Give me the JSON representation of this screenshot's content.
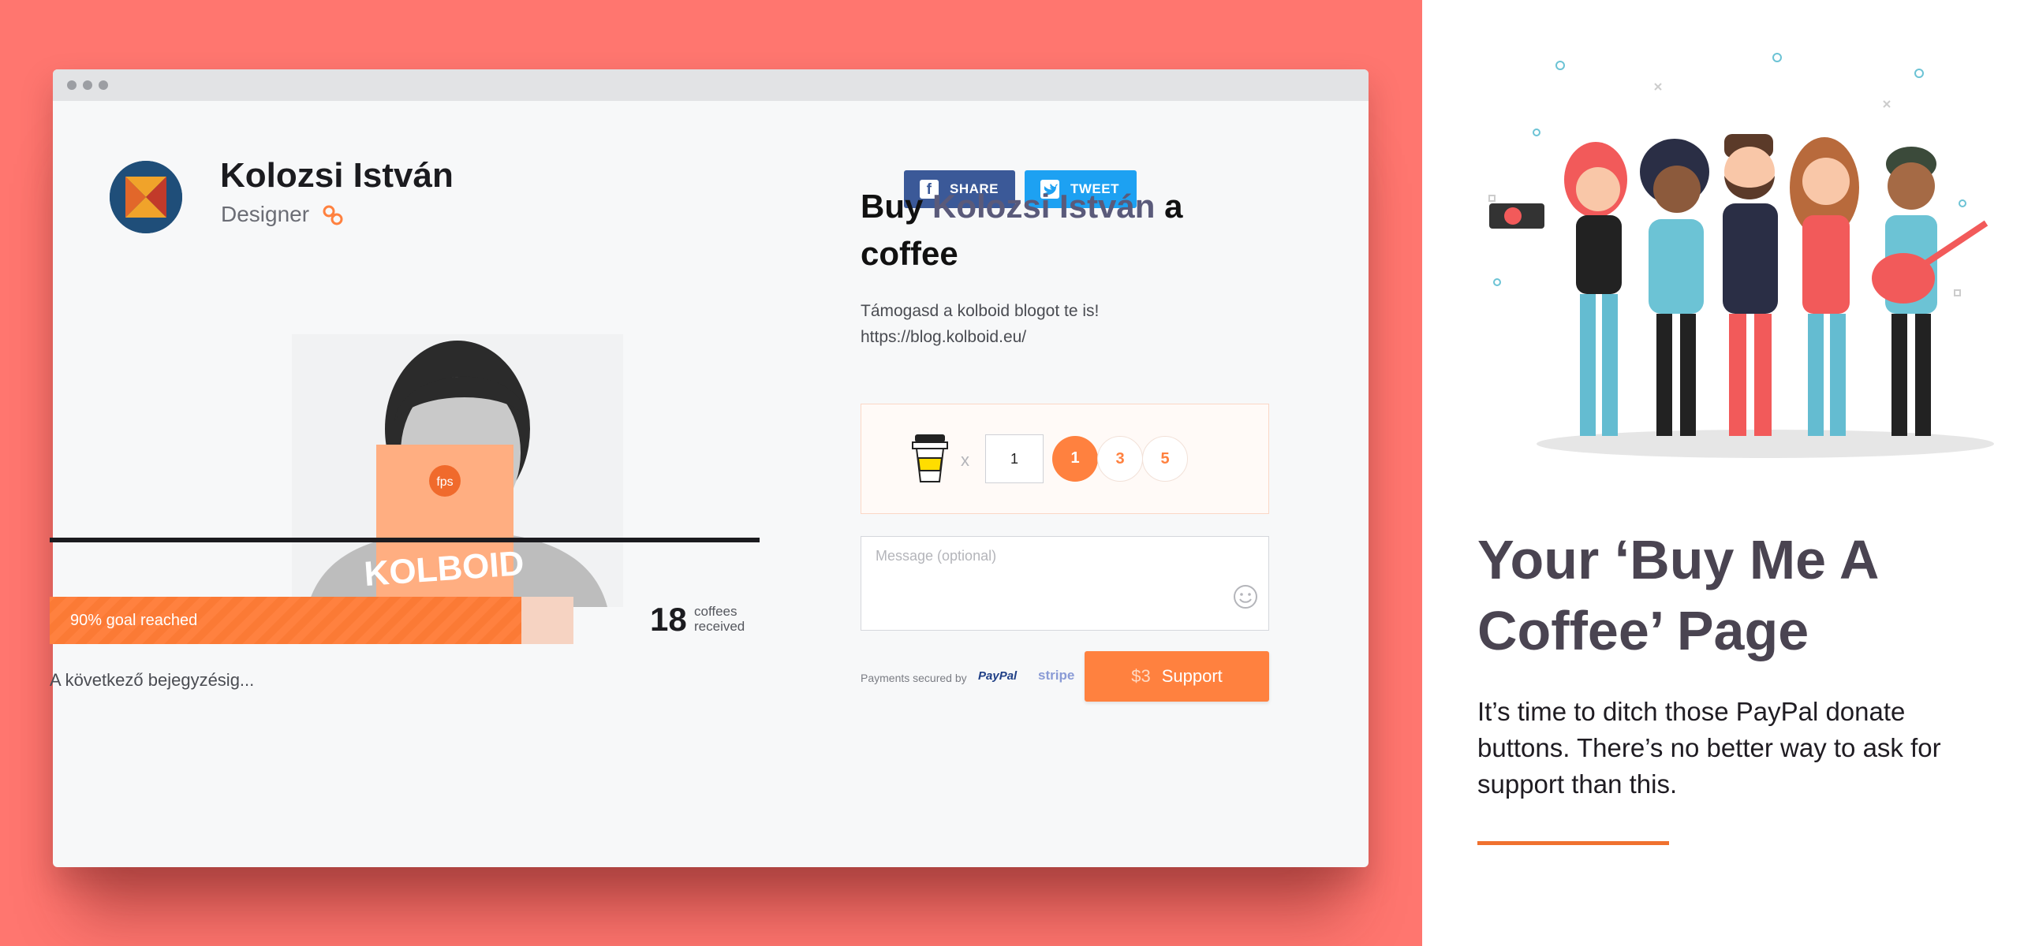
{
  "profile": {
    "name": "Kolozsi István",
    "role": "Designer"
  },
  "share": {
    "facebook_label": "SHARE",
    "twitter_label": "TWEET"
  },
  "photo": {
    "book_top_text": "fps",
    "book_text": "KOLBOID"
  },
  "goal": {
    "label": "90% goal reached",
    "percent": 90
  },
  "stats": {
    "count": "18",
    "label_line1": "coffees",
    "label_line2": "received"
  },
  "next_post": "A következő bejegyzésig...",
  "buy": {
    "prefix": "Buy",
    "name": "Kolozsi István",
    "suffix": "a coffee"
  },
  "description": {
    "line1": "Támogasd a kolboid blogot te is!",
    "line2": "https://blog.kolboid.eu/"
  },
  "quantity": {
    "times": "x",
    "value": "1",
    "options": [
      "1",
      "3",
      "5"
    ],
    "selected": "1"
  },
  "message": {
    "placeholder": "Message (optional)"
  },
  "payments": {
    "secured_label": "Payments secured by",
    "paypal": "PayPal",
    "stripe": "stripe"
  },
  "support": {
    "price": "$3",
    "label": "Support"
  },
  "panel": {
    "title": "Your ‘Buy Me A Coffee’ Page",
    "text": "It’s time to ditch those PayPal donate buttons. There’s no better way to ask for support than this."
  },
  "colors": {
    "background_coral": "#ff766f",
    "accent_orange": "#ff813f",
    "facebook_blue": "#3b5998",
    "twitter_blue": "#1da1f2"
  },
  "icons": [
    "link-icon",
    "facebook-icon",
    "twitter-icon",
    "coffee-cup-icon",
    "emoji-icon"
  ]
}
